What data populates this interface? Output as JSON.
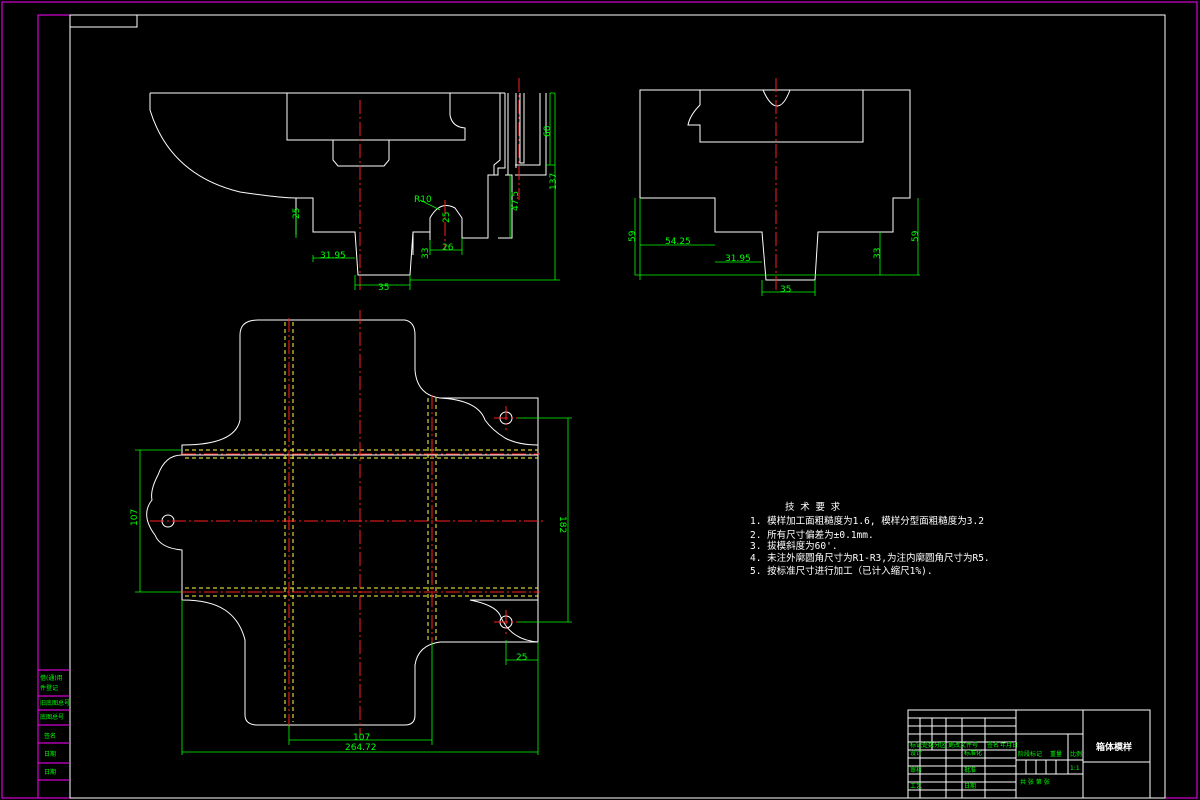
{
  "drawing": {
    "dimensions": {
      "front_31_95": "31.95",
      "front_25": "25",
      "front_35": "35",
      "front_33": "33",
      "front_26": "26",
      "front_r10": "R10",
      "front_25b": "25",
      "front_47_5": "47.5",
      "front_60": "60",
      "front_137": "137",
      "side_59a": "59",
      "side_54_25": "54.25",
      "side_31_95": "31.95",
      "side_35": "35",
      "side_33": "33",
      "side_59b": "59",
      "plan_107v": "107",
      "plan_182": "182",
      "plan_25": "25",
      "plan_107h": "107",
      "plan_264_72": "264.72"
    },
    "notes": {
      "title": "技  术  要  求",
      "items": [
        "1.  模样加工面粗糙度为1.6, 模样分型面粗糙度为3.2",
        "2. 所有尺寸偏差为±0.1mm.",
        "3. 拔模斜度为60'.",
        "4. 未注外廓圆角尺寸为R1-R3,为注内廓圆角尺寸为R5.",
        "5. 按标准尺寸进行加工（已计入缩尺1%)."
      ]
    },
    "side_labels": [
      "借(通)用",
      "件登记",
      "旧底图总号",
      "底图总号",
      "签名",
      "日期",
      "日期"
    ],
    "title_block": {
      "part_name": "箱体模样",
      "scale": "1:1",
      "sheet": "共  张  第  张",
      "row_labels": [
        "设计",
        "审核",
        "工艺"
      ],
      "right_labels": [
        "标准化",
        "批准",
        "日期"
      ],
      "header_labels": [
        "标记",
        "处数",
        "分区",
        "更改文件号",
        "签名",
        "年月日"
      ],
      "stage_labels": [
        "阶段标记",
        "重量",
        "比例"
      ]
    }
  }
}
